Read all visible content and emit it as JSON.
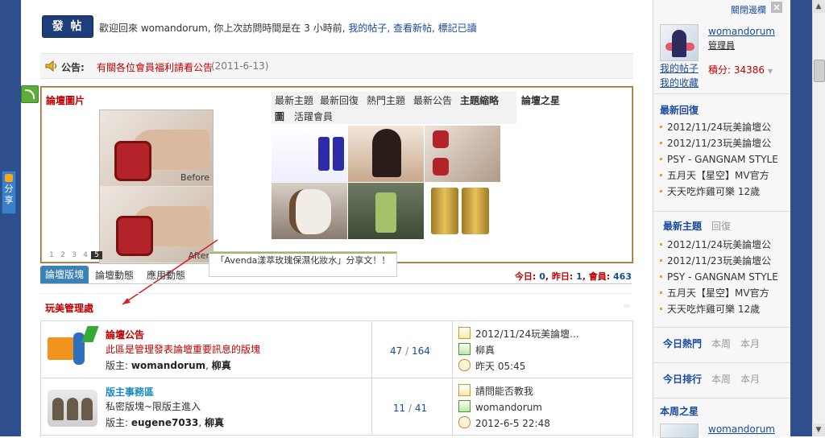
{
  "header": {
    "post_button": "發 帖",
    "welcome_prefix": "歡迎回來 womandorum, 你上次訪問時間是在 3 小時前,",
    "welcome_links": "我的帖子, 查看新帖, 標記已讀"
  },
  "notice": {
    "label": "公告:",
    "link": "有關各位會員福利請看公告",
    "date": "(2011-6-13)"
  },
  "slideshow": {
    "title": "論壇圖片",
    "before_label": "Before",
    "after_label": "After",
    "pages": [
      "1",
      "2",
      "3",
      "4",
      "5"
    ],
    "active_page": "5",
    "tooltip": "「Avenda漾萃玫瑰保濕化妝水」分享文！！"
  },
  "portal_tabs": {
    "tabs": [
      "最新主題",
      "最新回復",
      "熱門主題",
      "最新公告",
      "主題縮略",
      "論壇之星"
    ],
    "tab_last_line_prefix": "圖",
    "tab_active_members": "活躍會員"
  },
  "forum_tabs": {
    "tabs": [
      "論壇版塊",
      "論壇動態",
      "應用動態"
    ],
    "stats_today_label": "今日:",
    "stats_today": "0",
    "stats_yesterday_label": "昨日:",
    "stats_yesterday": "1",
    "stats_members_label": "會員:",
    "stats_members": "463"
  },
  "section": {
    "title": "玩美管理處"
  },
  "forums": [
    {
      "name": "論壇公告",
      "description": "此區是管理發表論壇重要訊息的版塊",
      "mods_label": "版主:",
      "mods": [
        "womandorum",
        "柳真"
      ],
      "topics": "47",
      "posts": "164",
      "last_title": "2012/11/24玩美論壇...",
      "last_user": "柳真",
      "last_time": "昨天 05:45"
    },
    {
      "name": "版主事務區",
      "description": "私密版塊~限版主進入",
      "mods_label": "版主:",
      "mods": [
        "eugene7033",
        "柳真"
      ],
      "topics": "11",
      "posts": "41",
      "last_title": "請問能否教我",
      "last_user": "womandorum",
      "last_time": "2012-6-5 22:48"
    }
  ],
  "sidebar": {
    "close_label": "關閉邊欄",
    "close_icon": "×",
    "username": "womandorum",
    "role": "管理員",
    "my_posts": "我的帖子",
    "my_favorites": "我的收藏",
    "points_label": "積分:",
    "points": "34386",
    "latest_replies_title": "最新回復",
    "latest_replies": [
      "2012/11/24玩美論壇公",
      "2012/11/23玩美論壇公",
      "PSY - GANGNAM STYLE",
      "五月天【星空】MV官方",
      "天天吃炸雞可樂 12歲"
    ],
    "latest_topics_title": "最新主題",
    "latest_topics_alt": "回復",
    "latest_topics": [
      "2012/11/24玩美論壇公",
      "2012/11/23玩美論壇公",
      "PSY - GANGNAM STYLE",
      "五月天【星空】MV官方",
      "天天吃炸雞可樂 12歲"
    ],
    "hot_today_title": "今日熱門",
    "hot_week": "本周",
    "hot_month": "本月",
    "rank_today_title": "今日排行",
    "rank_week": "本周",
    "rank_month": "本月",
    "star_title": "本周之星",
    "star_user": "womandorum"
  },
  "share_tab": "分享",
  "colors": {
    "accent_blue": "#1a4a9b",
    "accent_red": "#c00000",
    "frame_blue": "#2e4e8e",
    "tab_active": "#3a82b8"
  }
}
